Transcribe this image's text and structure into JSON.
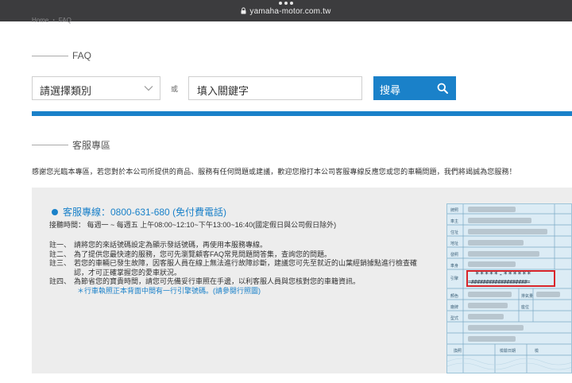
{
  "browser": {
    "url": "yamaha-motor.com.tw",
    "breadcrumb": "Home ・ FAQ"
  },
  "faq": {
    "heading": "FAQ",
    "category_select": {
      "value": "請選擇類別"
    },
    "or_label": "或",
    "keyword_input": {
      "value": "填入關鍵字",
      "placeholder": "填入關鍵字"
    },
    "search_button_label": "搜尋"
  },
  "service": {
    "heading": "客服專區",
    "intro": "感謝您光臨本專區，若您對於本公司所提供的商品、服務有任何問題或建議，歡迎您撥打本公司客服專線反應您或您的車輛問題，我們將竭誠為您服務！",
    "hotline": "客服專線：0800-631-680 (免付費電話)",
    "hours": "接聽時間： 每週一 ~ 每週五 上午08:00~12:10~下午13:00~16:40(國定假日與公司假日除外)",
    "notes": [
      {
        "label": "註一、",
        "lines": [
          "請將您的來話號碼設定為顯示發話號碼，再使用本服務專線。"
        ]
      },
      {
        "label": "註二、",
        "lines": [
          "為了提供您最快速的服務，您可先瀏覽顧客FAQ常見問題問答集，查詢您的問題。"
        ]
      },
      {
        "label": "註三、",
        "lines": [
          "若您的車輛已發生故障，因客服人員在線上無法進行故障診斷，建議您可先至就近的山葉經銷據點進行檢查確",
          "認，才可正確掌握您的愛車狀況。"
        ]
      },
      {
        "label": "註四、",
        "lines": [
          "為節省您的寶貴時間，請您可先備妥行車照在手邊，以利客服人員與您核對您的車籍資訊。"
        ]
      }
    ],
    "note_link": "＊行車執照正本背面中間有一行引擎號碼。(請參閱行照圖)"
  },
  "license_image": {
    "masked_line": "*****-******",
    "masked_engine": "=###################="
  },
  "colors": {
    "accent": "#1a81c9",
    "panel": "#ededed",
    "highlight": "#d9262b"
  }
}
